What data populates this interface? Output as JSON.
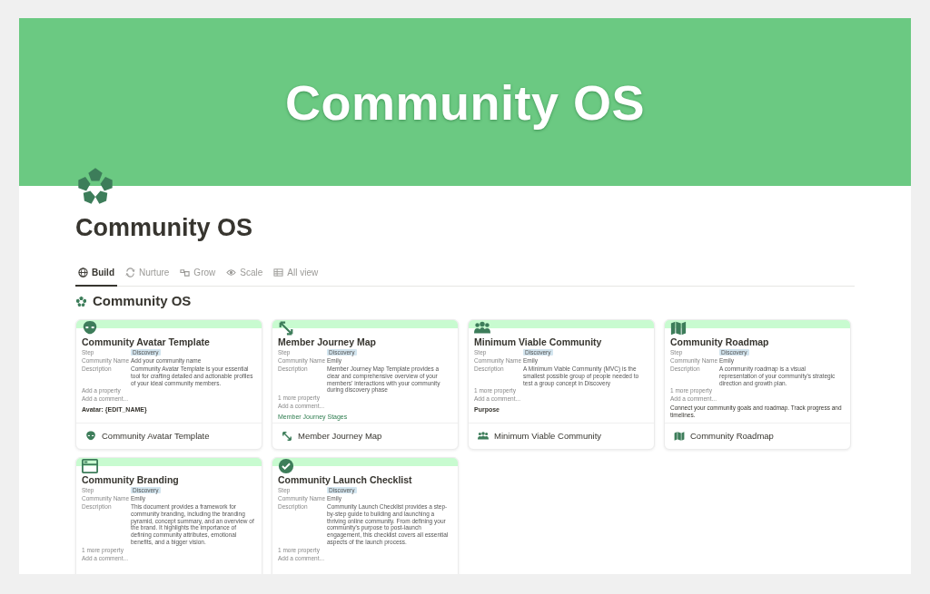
{
  "cover": {
    "title": "Community OS"
  },
  "page": {
    "title": "Community OS"
  },
  "tabs": [
    {
      "label": "Build",
      "selected": true
    },
    {
      "label": "Nurture",
      "selected": false
    },
    {
      "label": "Grow",
      "selected": false
    },
    {
      "label": "Scale",
      "selected": false
    },
    {
      "label": "All view",
      "selected": false
    }
  ],
  "section": {
    "title": "Community OS"
  },
  "cards": [
    {
      "preview_title": "Community Avatar Template",
      "properties": [
        {
          "label": "Step",
          "value": "Discovery",
          "kind": "tag"
        },
        {
          "label": "Community Name",
          "value": "Add your community name",
          "kind": "text"
        },
        {
          "label": "Description",
          "value": "Community Avatar Template is your essential tool for crafting detailed and actionable profiles of your ideal community members.",
          "kind": "text"
        }
      ],
      "more": "Add a property",
      "comment": "Add a comment...",
      "body": {
        "text": "Avatar: {EDIT_NAME}",
        "kind": "heading"
      },
      "title": "Community Avatar Template"
    },
    {
      "preview_title": "Member Journey Map",
      "properties": [
        {
          "label": "Step",
          "value": "Discovery",
          "kind": "tag"
        },
        {
          "label": "Community Name",
          "value": "Emily",
          "kind": "text"
        },
        {
          "label": "Description",
          "value": "Member Journey Map Template provides a clear and comprehensive overview of your members' interactions with your community during discovery phase",
          "kind": "text"
        }
      ],
      "more": "1 more property",
      "comment": "Add a comment...",
      "body": {
        "text": "Member Journey Stages",
        "kind": "link-heading"
      },
      "title": "Member Journey Map"
    },
    {
      "preview_title": "Minimum Viable Community",
      "properties": [
        {
          "label": "Step",
          "value": "Discovery",
          "kind": "tag"
        },
        {
          "label": "Community Name",
          "value": "Emily",
          "kind": "text"
        },
        {
          "label": "Description",
          "value": "A Minimum Viable Community (MVC) is the smallest possible group of people needed to test a group concept in Discovery",
          "kind": "text"
        }
      ],
      "more": "1 more property",
      "comment": "Add a comment...",
      "body": {
        "text": "Purpose",
        "kind": "heading"
      },
      "title": "Minimum Viable Community"
    },
    {
      "preview_title": "Community Roadmap",
      "properties": [
        {
          "label": "Step",
          "value": "Discovery",
          "kind": "tag"
        },
        {
          "label": "Community Name",
          "value": "Emily",
          "kind": "text"
        },
        {
          "label": "Description",
          "value": "A community roadmap is a visual representation of your community's strategic direction and growth plan.",
          "kind": "text"
        }
      ],
      "more": "1 more property",
      "comment": "Add a comment...",
      "body": {
        "text": "Connect your community goals and roadmap. Track progress and timelines.",
        "kind": "paragraph"
      },
      "title": "Community Roadmap"
    },
    {
      "preview_title": "Community Branding",
      "properties": [
        {
          "label": "Step",
          "value": "Discovery",
          "kind": "tag"
        },
        {
          "label": "Community Name",
          "value": "Emily",
          "kind": "text"
        },
        {
          "label": "Description",
          "value": "This document provides a framework for community branding, including the branding pyramid, concept summary, and an overview of the brand. It highlights the importance of defining community attributes, emotional benefits, and a bigger vision.",
          "kind": "text"
        }
      ],
      "more": "1 more property",
      "comment": "Add a comment..."
    },
    {
      "preview_title": "Community Launch Checklist",
      "properties": [
        {
          "label": "Step",
          "value": "Discovery",
          "kind": "tag"
        },
        {
          "label": "Community Name",
          "value": "Emily",
          "kind": "text"
        },
        {
          "label": "Description",
          "value": "Community Launch Checklist provides a step-by-step guide to building and launching a thriving online community. From defining your community's purpose to post-launch engagement, this checklist covers all essential aspects of the launch process.",
          "kind": "text"
        }
      ],
      "more": "1 more property",
      "comment": "Add a comment..."
    }
  ]
}
